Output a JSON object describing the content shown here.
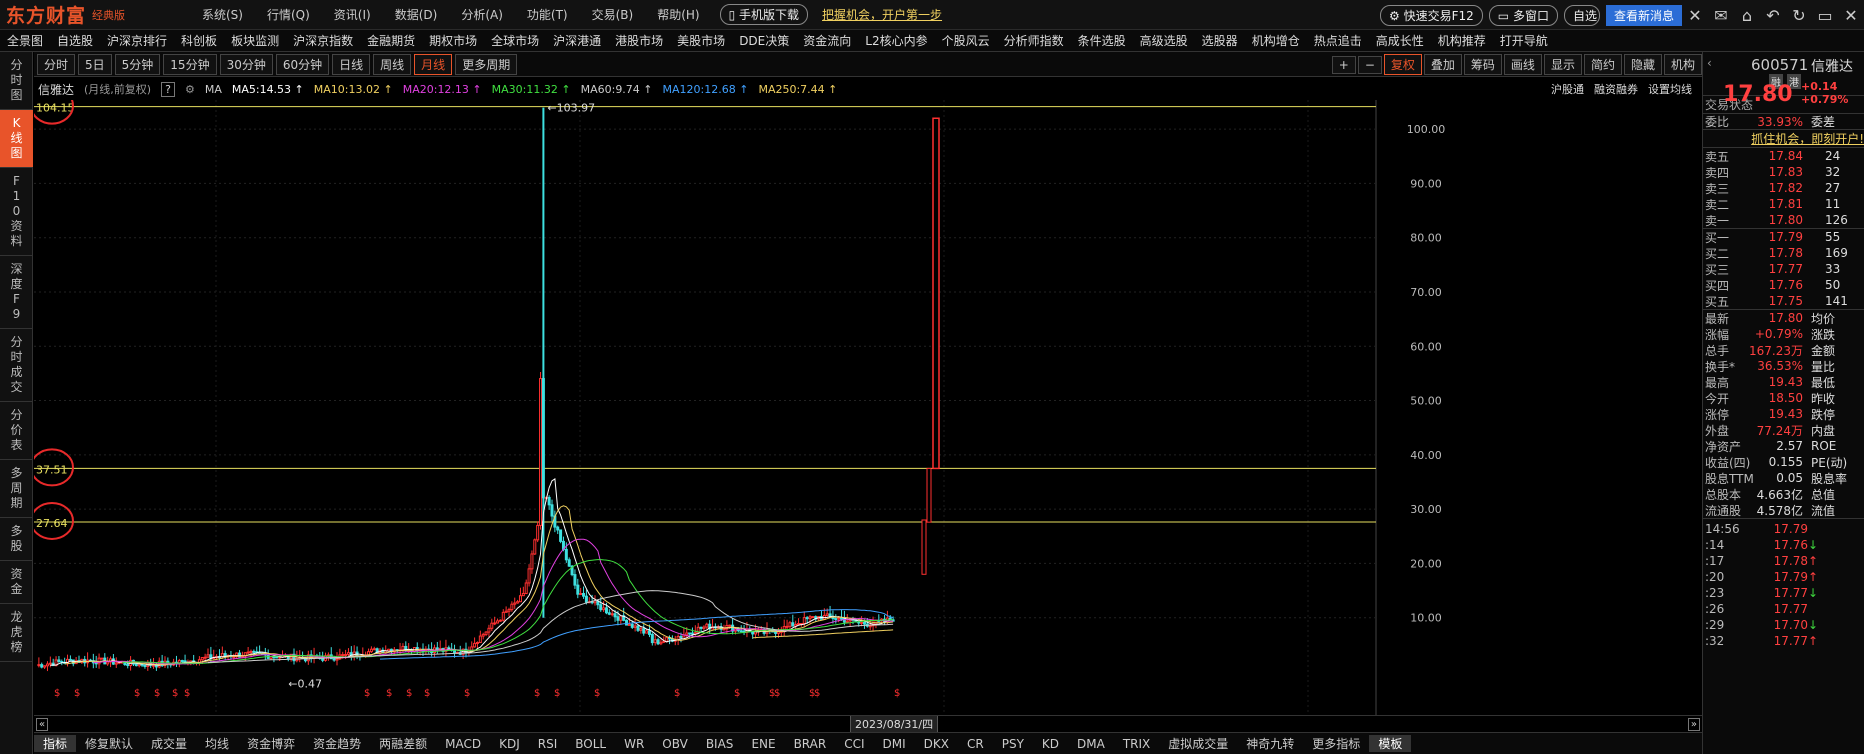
{
  "app": {
    "logo": "东方财富",
    "edition": "经典版"
  },
  "menu": [
    "系统(S)",
    "行情(Q)",
    "资讯(I)",
    "数据(D)",
    "分析(A)",
    "功能(T)",
    "交易(B)",
    "帮助(H)"
  ],
  "title_right": {
    "mobile_download": "手机版下载",
    "promo": "把握机会，开户第一步",
    "quick_trade": "快速交易F12",
    "multi_window": "多窗口",
    "self": "自选",
    "new_msg": "查看新消息",
    "msg_count": "1"
  },
  "nav": [
    "全景图",
    "自选股",
    "沪深京排行",
    "科创板",
    "板块监测",
    "沪深京指数",
    "金融期货",
    "期权市场",
    "全球市场",
    "沪深港通",
    "港股市场",
    "美股市场",
    "DDE决策",
    "资金流向",
    "L2核心内参",
    "个股风云",
    "分析师指数",
    "条件选股",
    "高级选股",
    "选股器",
    "机构增仓",
    "热点追击",
    "高成长性",
    "机构推荐",
    "打开导航"
  ],
  "left_tabs": [
    "分时图",
    "K线图",
    "F10资料",
    "深度F9",
    "分时成交",
    "分价表",
    "多周期",
    "多股",
    "资金",
    "龙虎榜"
  ],
  "periods": [
    "分时",
    "5日",
    "5分钟",
    "15分钟",
    "30分钟",
    "60分钟",
    "日线",
    "周线",
    "月线",
    "更多周期"
  ],
  "active_period": "月线",
  "tools": [
    "+",
    "−",
    "复权",
    "叠加",
    "筹码",
    "画线",
    "显示",
    "简约",
    "隐藏",
    "机构"
  ],
  "stock_title": {
    "name": "信雅达",
    "desc": "(月线,前复权)",
    "ma_label": "MA"
  },
  "ma": [
    {
      "label": "MA5:14.53",
      "color": "#ffffff"
    },
    {
      "label": "MA10:13.02",
      "color": "#f0d060"
    },
    {
      "label": "MA20:12.13",
      "color": "#e040e0"
    },
    {
      "label": "MA30:11.32",
      "color": "#40e040"
    },
    {
      "label": "MA60:9.74",
      "color": "#cccccc"
    },
    {
      "label": "MA120:12.68",
      "color": "#40a0ff"
    },
    {
      "label": "MA250:7.44",
      "color": "#f0d060"
    }
  ],
  "ma_right": [
    "沪股通",
    "融资融券",
    "设置均线"
  ],
  "levels": [
    "104.15",
    "37.51",
    "27.64"
  ],
  "peak_label": "103.97",
  "low_label": "0.47",
  "yaxis": [
    "100.00",
    "90.00",
    "80.00",
    "70.00",
    "60.00",
    "50.00",
    "40.00",
    "30.00",
    "20.00",
    "10.00"
  ],
  "date_label": "2023/08/31/四",
  "indicators": [
    "指标",
    "修复默认",
    "成交量",
    "均线",
    "资金博弈",
    "资金趋势",
    "两融差额",
    "MACD",
    "KDJ",
    "RSI",
    "BOLL",
    "WR",
    "OBV",
    "BIAS",
    "ENE",
    "BRAR",
    "CCI",
    "DMI",
    "DKX",
    "CR",
    "PSY",
    "KD",
    "DMA",
    "TRIX",
    "虚拟成交量",
    "神奇九转",
    "更多指标",
    "模板"
  ],
  "quote": {
    "code": "600571",
    "name": "信雅达",
    "price": "17.80",
    "chg": "+0.14",
    "pct": "+0.79%",
    "status": "交易状态",
    "webi_label": "委比",
    "webi": "33.93%",
    "weicha": "委差",
    "promo": "抓住机会，即刻开户!"
  },
  "asks": [
    [
      "卖五",
      "17.84",
      "24"
    ],
    [
      "卖四",
      "17.83",
      "32"
    ],
    [
      "卖三",
      "17.82",
      "27"
    ],
    [
      "卖二",
      "17.81",
      "11"
    ],
    [
      "卖一",
      "17.80",
      "126"
    ]
  ],
  "bids": [
    [
      "买一",
      "17.79",
      "55"
    ],
    [
      "买二",
      "17.78",
      "169"
    ],
    [
      "买三",
      "17.77",
      "33"
    ],
    [
      "买四",
      "17.76",
      "50"
    ],
    [
      "买五",
      "17.75",
      "141"
    ]
  ],
  "stats": [
    [
      "最新",
      "17.80",
      "均价"
    ],
    [
      "涨幅",
      "+0.79%",
      "涨跌"
    ],
    [
      "总手",
      "167.23万",
      "金额"
    ],
    [
      "换手*",
      "36.53%",
      "量比"
    ],
    [
      "最高",
      "19.43",
      "最低"
    ],
    [
      "今开",
      "18.50",
      "昨收"
    ],
    [
      "涨停",
      "19.43",
      "跌停"
    ],
    [
      "外盘",
      "77.24万",
      "内盘"
    ],
    [
      "净资产",
      "2.57",
      "ROE"
    ],
    [
      "收益(四)",
      "0.155",
      "PE(动)"
    ],
    [
      "股息TTM",
      "0.05",
      "股息率"
    ],
    [
      "总股本",
      "4.663亿",
      "总值"
    ],
    [
      "流通股",
      "4.578亿",
      "流值"
    ]
  ],
  "ticks": [
    [
      "14:56",
      "17.79",
      ""
    ],
    [
      ":14",
      "17.76",
      "↓"
    ],
    [
      ":17",
      "17.78",
      "↑"
    ],
    [
      ":20",
      "17.79",
      "↑"
    ],
    [
      ":23",
      "17.77",
      "↓"
    ],
    [
      ":26",
      "17.77",
      ""
    ],
    [
      ":29",
      "17.70",
      "↓"
    ],
    [
      ":32",
      "17.77",
      "↑"
    ]
  ]
}
